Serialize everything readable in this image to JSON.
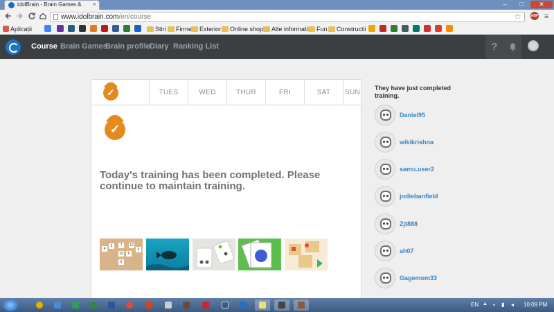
{
  "browser": {
    "tab_title": "idolBrain - Brain Games &",
    "tab_close": "×",
    "window_min": "–",
    "window_max": "□",
    "window_close": "✕",
    "url_domain": "www.idolbrain.com",
    "url_path": "/en/course",
    "back_icon": "arrow-left-icon",
    "forward_icon": "arrow-right-icon",
    "reload_icon": "reload-icon",
    "star_icon": "star-icon",
    "adblock_label": "ABP",
    "menu_icon": "hamburger-icon"
  },
  "bookmarks": {
    "apps_label": "Aplicații",
    "folders": [
      "Stiri",
      "Firme",
      "Exterior",
      "Online shops",
      "Alte informatii",
      "Fun",
      "Constructii"
    ]
  },
  "site": {
    "nav": [
      "Course",
      "Brain Games",
      "Brain profile",
      "Diary",
      "Ranking List"
    ],
    "help_label": "?",
    "bell_icon": "bell-icon",
    "avatar_icon": "user-avatar-icon"
  },
  "course": {
    "days": [
      "TUES",
      "WED",
      "THUR",
      "FRI",
      "SAT",
      "SUN"
    ],
    "today_check": "✓",
    "completed_message": "Today's training has been completed. Please continue to maintain training.",
    "puzzle_tiles": [
      "4",
      "1",
      "7",
      "12",
      "19",
      "9",
      "5",
      "6"
    ]
  },
  "sidebar": {
    "title": "They have just completed training.",
    "users": [
      "Daniel95",
      "wikikrishna",
      "samu.user2",
      "jodiebanfield",
      "Zjt888",
      "ah07",
      "Gagemom33"
    ]
  },
  "taskbar": {
    "language": "EN",
    "time": "10:09 PM"
  },
  "colors": {
    "header_bg": "#3b3f42",
    "accent_orange": "#e58a1f",
    "username_blue": "#3b84c2",
    "page_bg": "#efefef"
  }
}
